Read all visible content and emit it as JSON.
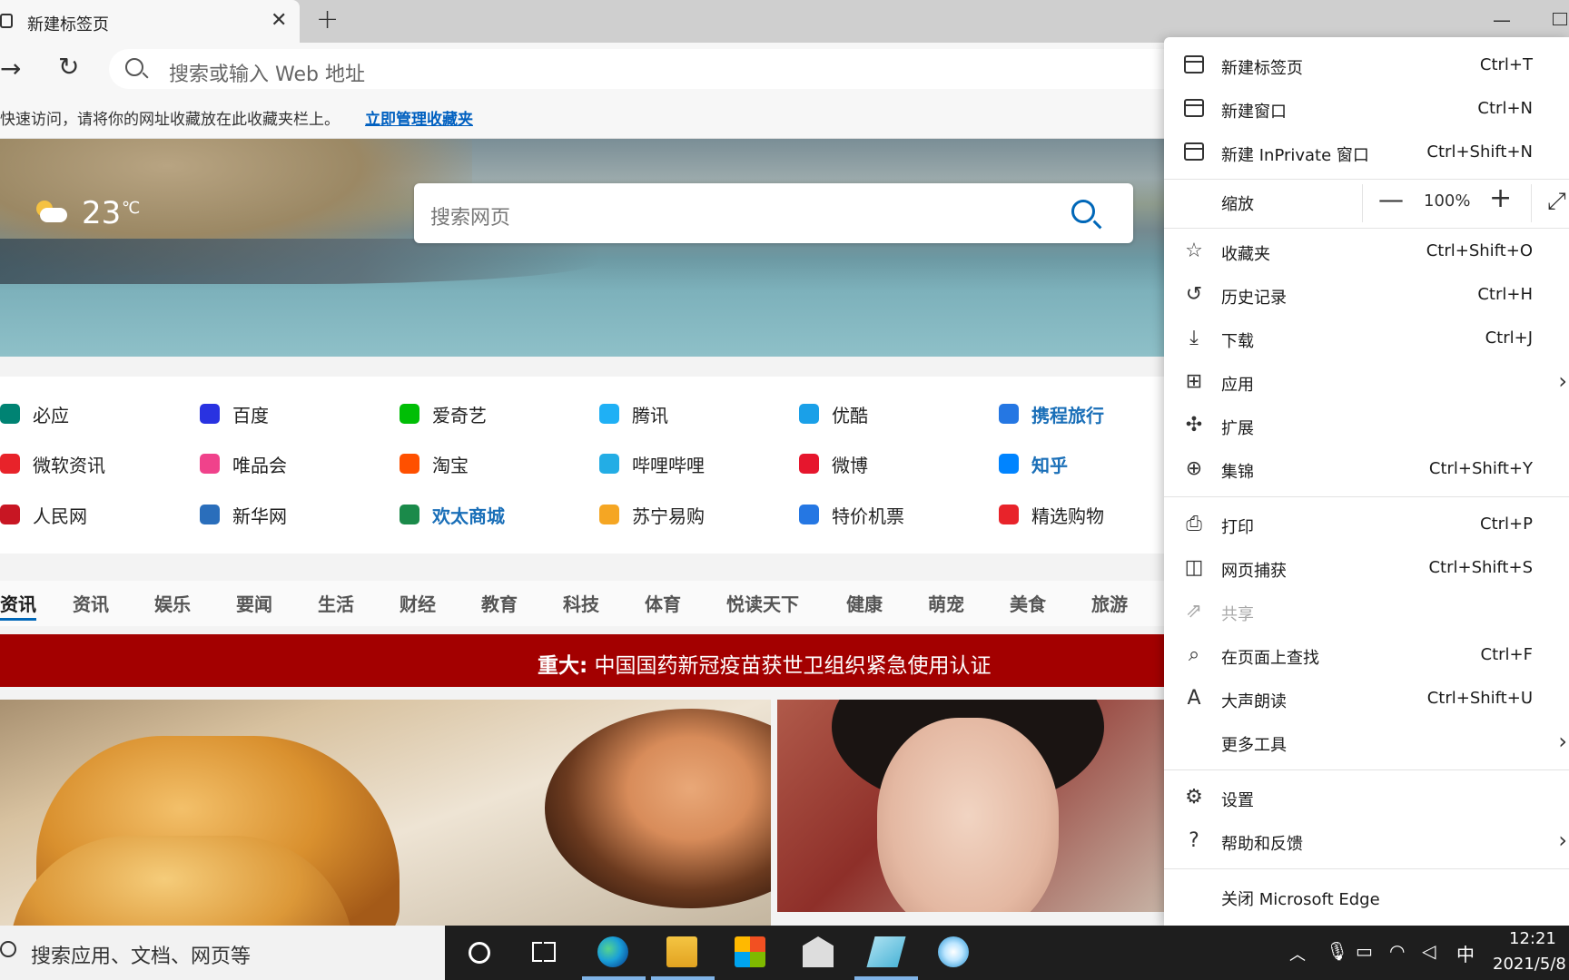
{
  "browser": {
    "tab_title": "新建标签页",
    "address_placeholder": "搜索或输入 Web 地址",
    "favorites_hint": "快速访问，请将你的网址收藏放在此收藏夹栏上。",
    "favorites_manage": "立即管理收藏夹"
  },
  "hero": {
    "temperature": "23",
    "temp_unit": "℃",
    "search_placeholder": "搜索网页"
  },
  "quick_links": [
    {
      "label": "必应",
      "color": "#008373",
      "bold": false
    },
    {
      "label": "百度",
      "color": "#2932e1",
      "bold": false
    },
    {
      "label": "爱奇艺",
      "color": "#00be06",
      "bold": false
    },
    {
      "label": "腾讯",
      "color": "#1fb0f5",
      "bold": false
    },
    {
      "label": "优酷",
      "color": "#1aa0e8",
      "bold": false
    },
    {
      "label": "携程旅行",
      "color": "#2577e3",
      "bold": true
    },
    {
      "label": "微软资讯",
      "color": "#e8232a",
      "bold": false
    },
    {
      "label": "唯品会",
      "color": "#f0428b",
      "bold": false
    },
    {
      "label": "淘宝",
      "color": "#ff5000",
      "bold": false
    },
    {
      "label": "哔哩哔哩",
      "color": "#23ade5",
      "bold": false
    },
    {
      "label": "微博",
      "color": "#e6162d",
      "bold": false
    },
    {
      "label": "知乎",
      "color": "#0084ff",
      "bold": true
    },
    {
      "label": "人民网",
      "color": "#c81623",
      "bold": false
    },
    {
      "label": "新华网",
      "color": "#2a6ebb",
      "bold": false
    },
    {
      "label": "欢太商城",
      "color": "#1a8a4a",
      "bold": true
    },
    {
      "label": "苏宁易购",
      "color": "#f5a623",
      "bold": false
    },
    {
      "label": "特价机票",
      "color": "#2577e3",
      "bold": false
    },
    {
      "label": "精选购物",
      "color": "#e8232a",
      "bold": false
    }
  ],
  "news_tabs": [
    "资讯",
    "资讯",
    "娱乐",
    "要闻",
    "生活",
    "财经",
    "教育",
    "科技",
    "体育",
    "悦读天下",
    "健康",
    "萌宠",
    "美食",
    "旅游"
  ],
  "banner": {
    "tag": "重大:",
    "headline": " 中国国药新冠疫苗获世卫组织紧急使用认证"
  },
  "menu": {
    "new_tab": {
      "label": "新建标签页",
      "shortcut": "Ctrl+T"
    },
    "new_window": {
      "label": "新建窗口",
      "shortcut": "Ctrl+N"
    },
    "new_inprivate": {
      "label": "新建 InPrivate 窗口",
      "shortcut": "Ctrl+Shift+N"
    },
    "zoom": {
      "label": "缩放",
      "value": "100%"
    },
    "favorites": {
      "label": "收藏夹",
      "shortcut": "Ctrl+Shift+O"
    },
    "history": {
      "label": "历史记录",
      "shortcut": "Ctrl+H"
    },
    "downloads": {
      "label": "下载",
      "shortcut": "Ctrl+J"
    },
    "apps": {
      "label": "应用"
    },
    "extensions": {
      "label": "扩展"
    },
    "collections": {
      "label": "集锦",
      "shortcut": "Ctrl+Shift+Y"
    },
    "print": {
      "label": "打印",
      "shortcut": "Ctrl+P"
    },
    "web_capture": {
      "label": "网页捕获",
      "shortcut": "Ctrl+Shift+S"
    },
    "share": {
      "label": "共享"
    },
    "find": {
      "label": "在页面上查找",
      "shortcut": "Ctrl+F"
    },
    "read_aloud": {
      "label": "大声朗读",
      "shortcut": "Ctrl+Shift+U"
    },
    "more_tools": {
      "label": "更多工具"
    },
    "settings": {
      "label": "设置"
    },
    "help": {
      "label": "帮助和反馈"
    },
    "close": {
      "label": "关闭 Microsoft Edge"
    }
  },
  "taskbar": {
    "search_placeholder": "搜索应用、文档、网页等",
    "ime": "中",
    "time": "12:21",
    "date": "2021/5/8"
  }
}
